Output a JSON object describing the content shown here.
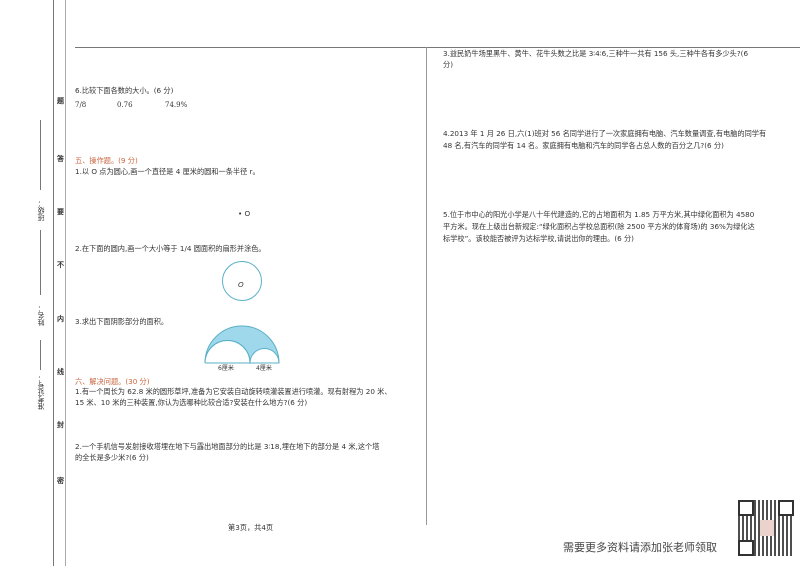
{
  "binding": {
    "class_label": "班级：",
    "name_label": "姓名：",
    "id_label": "准考证号：",
    "seal_chars": [
      "题",
      "答",
      "要",
      "不",
      "内",
      "线",
      "封",
      "密"
    ]
  },
  "left": {
    "q6": {
      "text": "6.比较下面各数的大小。(6 分)",
      "values": [
        "7/8",
        "0.76",
        "74.9%"
      ]
    },
    "section5": "五、操作题。(9 分)",
    "s5q1": "1.以 O 点为圆心,画一个直径是 4 厘米的圆和一条半径 r。",
    "point_label": "• O",
    "s5q2": "2.在下面的圆内,画一个大小等于 1/4 圆面积的扇形并涂色。",
    "circle_center": "O",
    "s5q3": "3.求出下面阴影部分的面积。",
    "dim1": "6厘米",
    "dim2": "4厘米",
    "section6": "六、解决问题。(30 分)",
    "s6q1": [
      "1.有一个周长为 62.8 米的圆形草坪,准备为它安装自动旋转喷灌装置进行喷灌。现有射程为 20 米、",
      "15 米、10 米的三种装置,你认为选哪种比较合适?安装在什么地方?(6 分)"
    ],
    "s6q2": [
      "2.一个手机信号发射接收塔埋在地下与露出地面部分的比是 3∶18,埋在地下的部分是 4 米,这个塔",
      "的全长是多少米?(6 分)"
    ],
    "footer": "第3页，共4页"
  },
  "right": {
    "q3": [
      "3.益民奶牛场里黑牛、黄牛、花牛头数之比是 3∶4∶6,三种牛一共有 156 头,三种牛各有多少头?(6",
      "分)"
    ],
    "q4": [
      "4.2013 年 1 月 26 日,六(1)班对 56 名同学进行了一次家庭拥有电脑、汽车数量调查,有电脑的同学有",
      "48 名,有汽车的同学有 14 名。家庭拥有电脑和汽车的同学各占总人数的百分之几?(6 分)"
    ],
    "q5": [
      "5.位于市中心的阳光小学是八十年代建造的,它的占地面积为 1.85 万平方米,其中绿化面积为 4580",
      "平方米。现在上级出台新规定:“绿化面积占学校总面积(除 2500 平方米的体育场)的 36%为绿化达",
      "标学校”。该校能否被评为达标学校,请说出你的理由。(6 分)"
    ]
  },
  "promo": "需要更多资料请添加张老师领取",
  "colors": {
    "accent": "#c8643c",
    "shade": "#9ed8ea",
    "stroke": "#5ab0c8"
  }
}
